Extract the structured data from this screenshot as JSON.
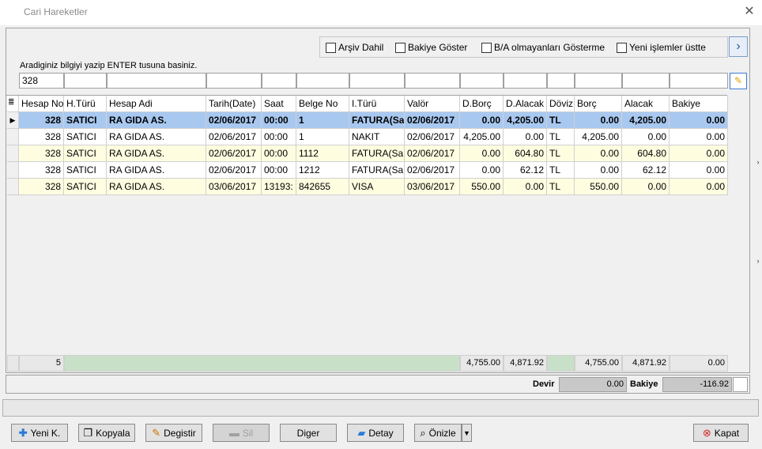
{
  "window": {
    "title": "Cari Hareketler",
    "close": "✕"
  },
  "options": {
    "arsiv": "Arşiv Dahil",
    "bakiye_goster": "Bakiye Göster",
    "ba_olmayan": "B/A olmayanları Gösterme",
    "yeni_islemler": "Yeni işlemler üstte",
    "nav": "›"
  },
  "hint": "Aradiginiz bilgiyi yazip ENTER tusuna basiniz.",
  "filter_value": "328",
  "grid": {
    "headers": [
      "Hesap No",
      "H.Türü",
      "Hesap Adi",
      "Tarih(Date)",
      "Saat",
      "Belge No",
      "I.Türü",
      "Valör",
      "D.Borç",
      "D.Alacak",
      "Döviz",
      "Borç",
      "Alacak",
      "Bakiye"
    ],
    "rows": [
      [
        "328",
        "SATICI",
        "RA GIDA  AS.",
        "02/06/2017",
        "00:00",
        "1",
        "FATURA(Sa",
        "02/06/2017",
        "0.00",
        "4,205.00",
        "TL",
        "0.00",
        "4,205.00",
        "0.00"
      ],
      [
        "328",
        "SATICI",
        "RA GIDA  AS.",
        "02/06/2017",
        "00:00",
        "1",
        "NAKIT",
        "02/06/2017",
        "4,205.00",
        "0.00",
        "TL",
        "4,205.00",
        "0.00",
        "0.00"
      ],
      [
        "328",
        "SATICI",
        "RA GIDA  AS.",
        "02/06/2017",
        "00:00",
        "1112",
        "FATURA(Sa",
        "02/06/2017",
        "0.00",
        "604.80",
        "TL",
        "0.00",
        "604.80",
        "0.00"
      ],
      [
        "328",
        "SATICI",
        "RA GIDA  AS.",
        "02/06/2017",
        "00:00",
        "1212",
        "FATURA(Sa",
        "02/06/2017",
        "0.00",
        "62.12",
        "TL",
        "0.00",
        "62.12",
        "0.00"
      ],
      [
        "328",
        "SATICI",
        "RA GIDA  AS.",
        "03/06/2017",
        "13193:",
        "842655",
        "VISA",
        "03/06/2017",
        "550.00",
        "0.00",
        "TL",
        "550.00",
        "0.00",
        "0.00"
      ]
    ],
    "footer": {
      "count": "5",
      "d_borc": "4,755.00",
      "d_alacak": "4,871.92",
      "borc": "4,755.00",
      "alacak": "4,871.92",
      "bakiye": "0.00"
    }
  },
  "summary": {
    "devir_label": "Devir",
    "devir_value": "0.00",
    "bakiye_label": "Bakiye",
    "bakiye_value": "-116.92"
  },
  "buttons": {
    "yeni": "Yeni K.",
    "kopyala": "Kopyala",
    "degistir": "Degistir",
    "sil": "Sil",
    "diger": "Diger",
    "detay": "Detay",
    "onizle": "Önizle",
    "kapat": "Kapat"
  }
}
